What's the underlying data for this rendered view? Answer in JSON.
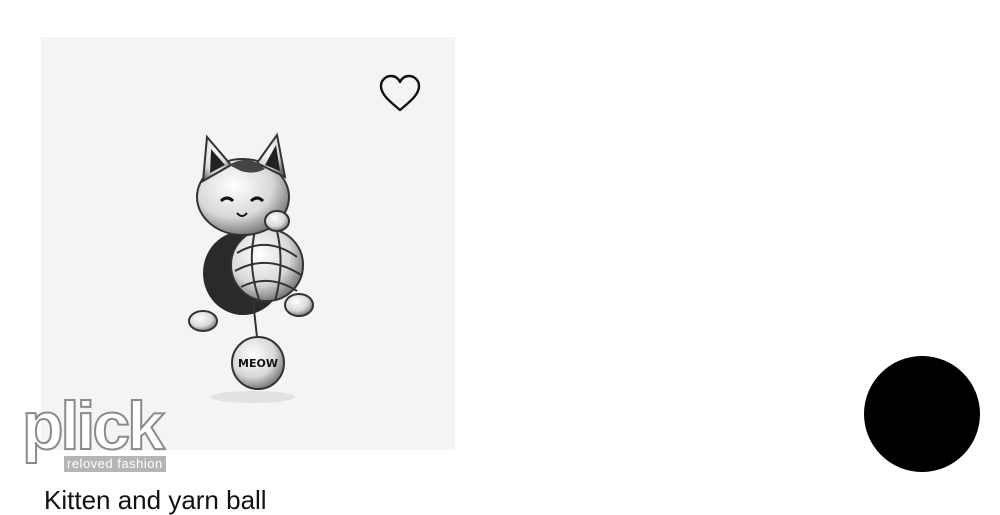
{
  "product": {
    "title": "Kitten and yarn ball",
    "image_icon": "cat-yarn-charm-icon",
    "engraving": "MEOW",
    "wishlist_icon": "heart-outline-icon"
  },
  "watermark": {
    "word": "plick",
    "tagline": "reloved fashion"
  },
  "colors": {
    "card_background": "#f4f4f4",
    "fab": "#000000"
  }
}
